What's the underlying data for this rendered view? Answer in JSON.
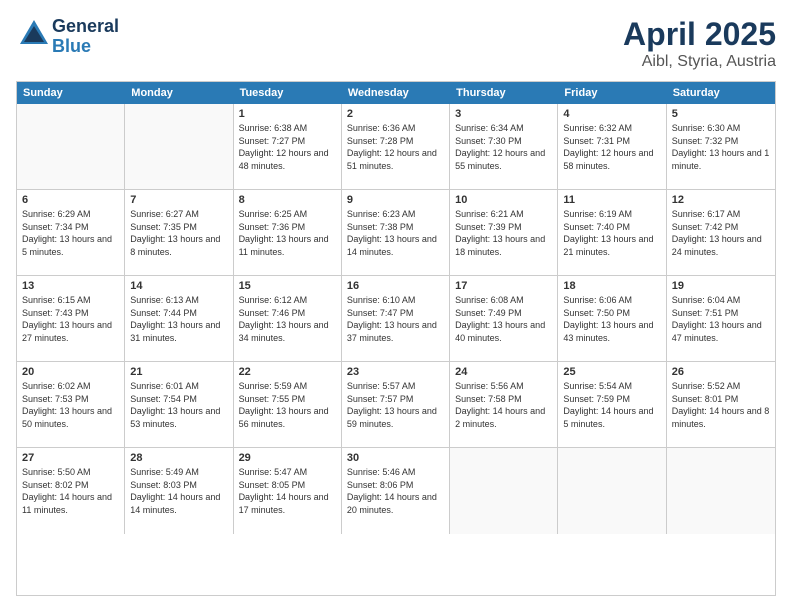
{
  "logo": {
    "general": "General",
    "blue": "Blue"
  },
  "title": "April 2025",
  "subtitle": "Aibl, Styria, Austria",
  "header_days": [
    "Sunday",
    "Monday",
    "Tuesday",
    "Wednesday",
    "Thursday",
    "Friday",
    "Saturday"
  ],
  "weeks": [
    [
      {
        "day": "",
        "sunrise": "",
        "sunset": "",
        "daylight": ""
      },
      {
        "day": "",
        "sunrise": "",
        "sunset": "",
        "daylight": ""
      },
      {
        "day": "1",
        "sunrise": "Sunrise: 6:38 AM",
        "sunset": "Sunset: 7:27 PM",
        "daylight": "Daylight: 12 hours and 48 minutes."
      },
      {
        "day": "2",
        "sunrise": "Sunrise: 6:36 AM",
        "sunset": "Sunset: 7:28 PM",
        "daylight": "Daylight: 12 hours and 51 minutes."
      },
      {
        "day": "3",
        "sunrise": "Sunrise: 6:34 AM",
        "sunset": "Sunset: 7:30 PM",
        "daylight": "Daylight: 12 hours and 55 minutes."
      },
      {
        "day": "4",
        "sunrise": "Sunrise: 6:32 AM",
        "sunset": "Sunset: 7:31 PM",
        "daylight": "Daylight: 12 hours and 58 minutes."
      },
      {
        "day": "5",
        "sunrise": "Sunrise: 6:30 AM",
        "sunset": "Sunset: 7:32 PM",
        "daylight": "Daylight: 13 hours and 1 minute."
      }
    ],
    [
      {
        "day": "6",
        "sunrise": "Sunrise: 6:29 AM",
        "sunset": "Sunset: 7:34 PM",
        "daylight": "Daylight: 13 hours and 5 minutes."
      },
      {
        "day": "7",
        "sunrise": "Sunrise: 6:27 AM",
        "sunset": "Sunset: 7:35 PM",
        "daylight": "Daylight: 13 hours and 8 minutes."
      },
      {
        "day": "8",
        "sunrise": "Sunrise: 6:25 AM",
        "sunset": "Sunset: 7:36 PM",
        "daylight": "Daylight: 13 hours and 11 minutes."
      },
      {
        "day": "9",
        "sunrise": "Sunrise: 6:23 AM",
        "sunset": "Sunset: 7:38 PM",
        "daylight": "Daylight: 13 hours and 14 minutes."
      },
      {
        "day": "10",
        "sunrise": "Sunrise: 6:21 AM",
        "sunset": "Sunset: 7:39 PM",
        "daylight": "Daylight: 13 hours and 18 minutes."
      },
      {
        "day": "11",
        "sunrise": "Sunrise: 6:19 AM",
        "sunset": "Sunset: 7:40 PM",
        "daylight": "Daylight: 13 hours and 21 minutes."
      },
      {
        "day": "12",
        "sunrise": "Sunrise: 6:17 AM",
        "sunset": "Sunset: 7:42 PM",
        "daylight": "Daylight: 13 hours and 24 minutes."
      }
    ],
    [
      {
        "day": "13",
        "sunrise": "Sunrise: 6:15 AM",
        "sunset": "Sunset: 7:43 PM",
        "daylight": "Daylight: 13 hours and 27 minutes."
      },
      {
        "day": "14",
        "sunrise": "Sunrise: 6:13 AM",
        "sunset": "Sunset: 7:44 PM",
        "daylight": "Daylight: 13 hours and 31 minutes."
      },
      {
        "day": "15",
        "sunrise": "Sunrise: 6:12 AM",
        "sunset": "Sunset: 7:46 PM",
        "daylight": "Daylight: 13 hours and 34 minutes."
      },
      {
        "day": "16",
        "sunrise": "Sunrise: 6:10 AM",
        "sunset": "Sunset: 7:47 PM",
        "daylight": "Daylight: 13 hours and 37 minutes."
      },
      {
        "day": "17",
        "sunrise": "Sunrise: 6:08 AM",
        "sunset": "Sunset: 7:49 PM",
        "daylight": "Daylight: 13 hours and 40 minutes."
      },
      {
        "day": "18",
        "sunrise": "Sunrise: 6:06 AM",
        "sunset": "Sunset: 7:50 PM",
        "daylight": "Daylight: 13 hours and 43 minutes."
      },
      {
        "day": "19",
        "sunrise": "Sunrise: 6:04 AM",
        "sunset": "Sunset: 7:51 PM",
        "daylight": "Daylight: 13 hours and 47 minutes."
      }
    ],
    [
      {
        "day": "20",
        "sunrise": "Sunrise: 6:02 AM",
        "sunset": "Sunset: 7:53 PM",
        "daylight": "Daylight: 13 hours and 50 minutes."
      },
      {
        "day": "21",
        "sunrise": "Sunrise: 6:01 AM",
        "sunset": "Sunset: 7:54 PM",
        "daylight": "Daylight: 13 hours and 53 minutes."
      },
      {
        "day": "22",
        "sunrise": "Sunrise: 5:59 AM",
        "sunset": "Sunset: 7:55 PM",
        "daylight": "Daylight: 13 hours and 56 minutes."
      },
      {
        "day": "23",
        "sunrise": "Sunrise: 5:57 AM",
        "sunset": "Sunset: 7:57 PM",
        "daylight": "Daylight: 13 hours and 59 minutes."
      },
      {
        "day": "24",
        "sunrise": "Sunrise: 5:56 AM",
        "sunset": "Sunset: 7:58 PM",
        "daylight": "Daylight: 14 hours and 2 minutes."
      },
      {
        "day": "25",
        "sunrise": "Sunrise: 5:54 AM",
        "sunset": "Sunset: 7:59 PM",
        "daylight": "Daylight: 14 hours and 5 minutes."
      },
      {
        "day": "26",
        "sunrise": "Sunrise: 5:52 AM",
        "sunset": "Sunset: 8:01 PM",
        "daylight": "Daylight: 14 hours and 8 minutes."
      }
    ],
    [
      {
        "day": "27",
        "sunrise": "Sunrise: 5:50 AM",
        "sunset": "Sunset: 8:02 PM",
        "daylight": "Daylight: 14 hours and 11 minutes."
      },
      {
        "day": "28",
        "sunrise": "Sunrise: 5:49 AM",
        "sunset": "Sunset: 8:03 PM",
        "daylight": "Daylight: 14 hours and 14 minutes."
      },
      {
        "day": "29",
        "sunrise": "Sunrise: 5:47 AM",
        "sunset": "Sunset: 8:05 PM",
        "daylight": "Daylight: 14 hours and 17 minutes."
      },
      {
        "day": "30",
        "sunrise": "Sunrise: 5:46 AM",
        "sunset": "Sunset: 8:06 PM",
        "daylight": "Daylight: 14 hours and 20 minutes."
      },
      {
        "day": "",
        "sunrise": "",
        "sunset": "",
        "daylight": ""
      },
      {
        "day": "",
        "sunrise": "",
        "sunset": "",
        "daylight": ""
      },
      {
        "day": "",
        "sunrise": "",
        "sunset": "",
        "daylight": ""
      }
    ]
  ]
}
